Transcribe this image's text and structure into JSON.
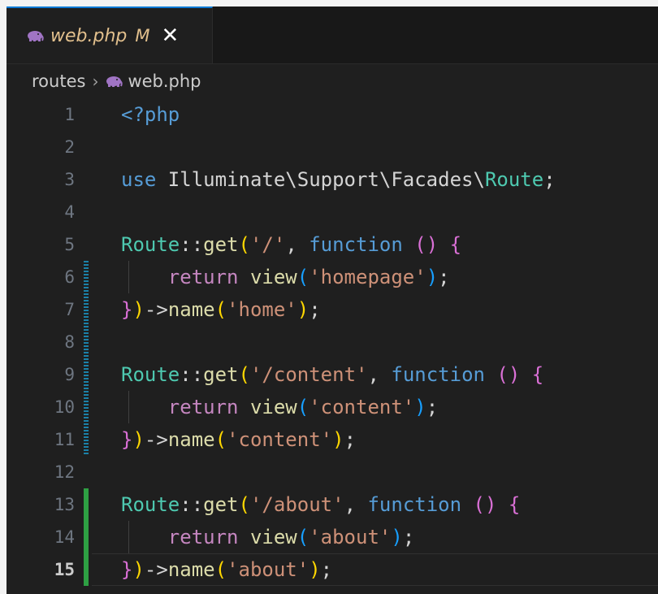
{
  "tab": {
    "icon": "php-elephant-icon",
    "filename": "web.php",
    "status": "M",
    "close": "✕"
  },
  "breadcrumb": {
    "folder": "routes",
    "separator": "›",
    "icon": "php-elephant-icon",
    "file": "web.php"
  },
  "colors": {
    "keyword": "#569cd6",
    "function": "#dcdcaa",
    "string": "#ce9178",
    "class": "#4ec9b0",
    "bracket_yellow": "#ffd700",
    "bracket_purple": "#da70d6",
    "bracket_blue": "#179fff",
    "git_modified": "#1b81a8",
    "git_added": "#2ea043"
  },
  "editor": {
    "active_line": 15,
    "lines": [
      {
        "num": "1",
        "tokens": [
          [
            "k-tag",
            "<?php"
          ]
        ]
      },
      {
        "num": "2",
        "tokens": []
      },
      {
        "num": "3",
        "tokens": [
          [
            "k-kw",
            "use "
          ],
          [
            "k-ns",
            "Illuminate\\Support\\Facades\\"
          ],
          [
            "k-cls",
            "Route"
          ],
          [
            "k-plain",
            ";"
          ]
        ]
      },
      {
        "num": "4",
        "tokens": []
      },
      {
        "num": "5",
        "tokens": [
          [
            "k-cls",
            "Route"
          ],
          [
            "k-op",
            "::"
          ],
          [
            "k-fn",
            "get"
          ],
          [
            "k-b1",
            "("
          ],
          [
            "k-str",
            "'/'"
          ],
          [
            "k-plain",
            ", "
          ],
          [
            "k-kw",
            "function "
          ],
          [
            "k-b2",
            "() {"
          ]
        ]
      },
      {
        "num": "6",
        "guide": true,
        "tokens": [
          [
            "k-plain",
            "    "
          ],
          [
            "k-ret",
            "return "
          ],
          [
            "k-fn",
            "view"
          ],
          [
            "k-b3",
            "("
          ],
          [
            "k-str",
            "'homepage'"
          ],
          [
            "k-b3",
            ")"
          ],
          [
            "k-plain",
            ";"
          ]
        ]
      },
      {
        "num": "7",
        "tokens": [
          [
            "k-b2",
            "}"
          ],
          [
            "k-b1",
            ")"
          ],
          [
            "k-op",
            "->"
          ],
          [
            "k-fn",
            "name"
          ],
          [
            "k-b1",
            "("
          ],
          [
            "k-str",
            "'home'"
          ],
          [
            "k-b1",
            ")"
          ],
          [
            "k-plain",
            ";"
          ]
        ]
      },
      {
        "num": "8",
        "tokens": []
      },
      {
        "num": "9",
        "tokens": [
          [
            "k-cls",
            "Route"
          ],
          [
            "k-op",
            "::"
          ],
          [
            "k-fn",
            "get"
          ],
          [
            "k-b1",
            "("
          ],
          [
            "k-str",
            "'/content'"
          ],
          [
            "k-plain",
            ", "
          ],
          [
            "k-kw",
            "function "
          ],
          [
            "k-b2",
            "() {"
          ]
        ]
      },
      {
        "num": "10",
        "guide": true,
        "tokens": [
          [
            "k-plain",
            "    "
          ],
          [
            "k-ret",
            "return "
          ],
          [
            "k-fn",
            "view"
          ],
          [
            "k-b3",
            "("
          ],
          [
            "k-str",
            "'content'"
          ],
          [
            "k-b3",
            ")"
          ],
          [
            "k-plain",
            ";"
          ]
        ]
      },
      {
        "num": "11",
        "tokens": [
          [
            "k-b2",
            "}"
          ],
          [
            "k-b1",
            ")"
          ],
          [
            "k-op",
            "->"
          ],
          [
            "k-fn",
            "name"
          ],
          [
            "k-b1",
            "("
          ],
          [
            "k-str",
            "'content'"
          ],
          [
            "k-b1",
            ")"
          ],
          [
            "k-plain",
            ";"
          ]
        ]
      },
      {
        "num": "12",
        "tokens": []
      },
      {
        "num": "13",
        "tokens": [
          [
            "k-cls",
            "Route"
          ],
          [
            "k-op",
            "::"
          ],
          [
            "k-fn",
            "get"
          ],
          [
            "k-b1",
            "("
          ],
          [
            "k-str",
            "'/about'"
          ],
          [
            "k-plain",
            ", "
          ],
          [
            "k-kw",
            "function "
          ],
          [
            "k-b2",
            "() {"
          ]
        ]
      },
      {
        "num": "14",
        "guide": true,
        "tokens": [
          [
            "k-plain",
            "    "
          ],
          [
            "k-ret",
            "return "
          ],
          [
            "k-fn",
            "view"
          ],
          [
            "k-b3",
            "("
          ],
          [
            "k-str",
            "'about'"
          ],
          [
            "k-b3",
            ")"
          ],
          [
            "k-plain",
            ";"
          ]
        ]
      },
      {
        "num": "15",
        "tokens": [
          [
            "k-b2",
            "}"
          ],
          [
            "k-b1",
            ")"
          ],
          [
            "k-op",
            "->"
          ],
          [
            "k-fn",
            "name"
          ],
          [
            "k-b1",
            "("
          ],
          [
            "k-str",
            "'about'"
          ],
          [
            "k-b1",
            ")"
          ],
          [
            "k-plain",
            ";"
          ]
        ]
      }
    ],
    "git_modified_lines": [
      6,
      7,
      8,
      9,
      10,
      11
    ],
    "git_added_lines": [
      13,
      14,
      15
    ]
  }
}
